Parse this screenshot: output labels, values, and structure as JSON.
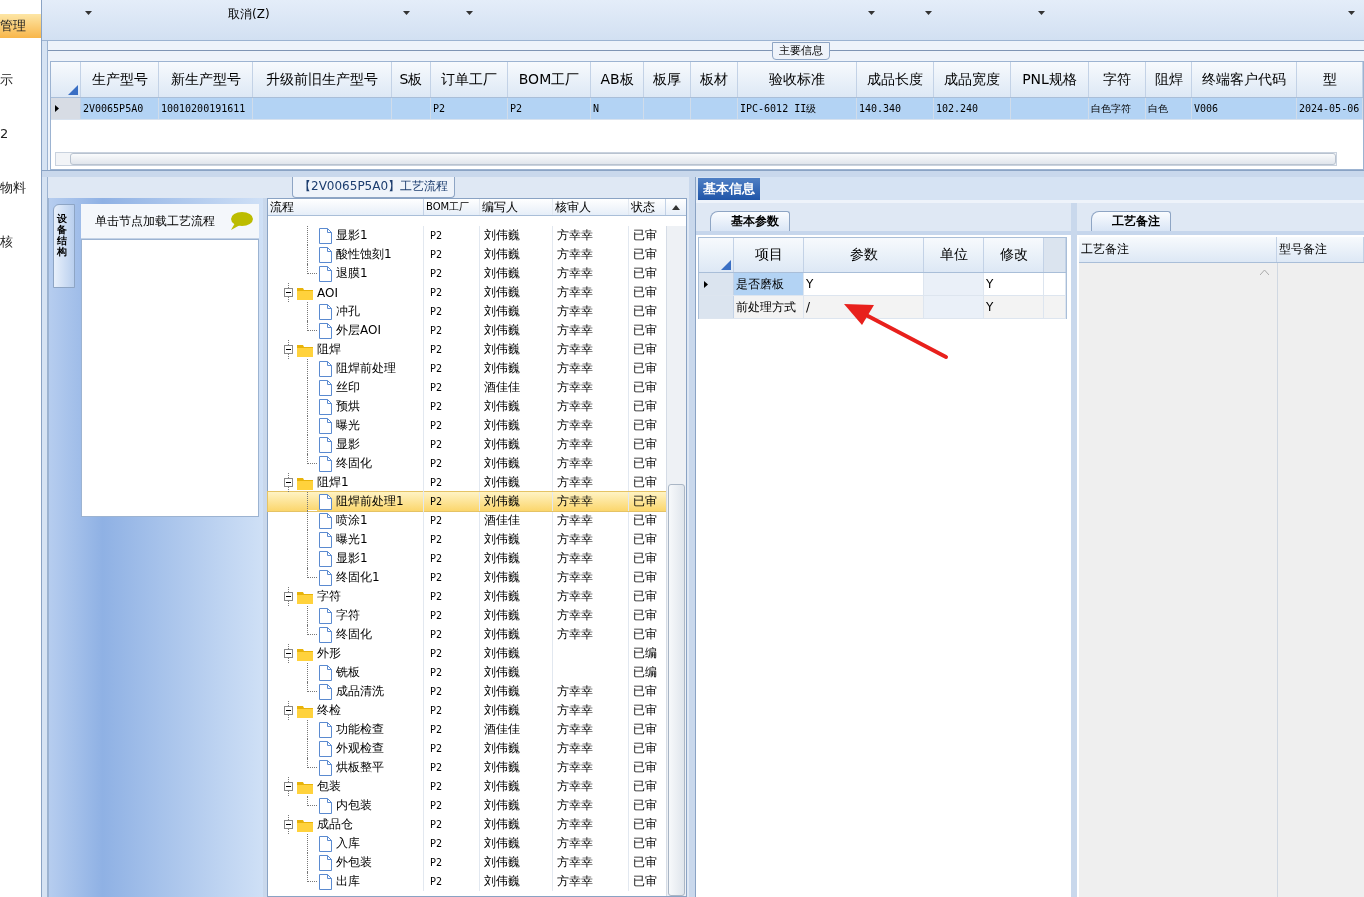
{
  "nav": {
    "items": [
      {
        "label": "管理",
        "selected": true
      },
      {
        "label": "示",
        "selected": false
      },
      {
        "label": "2",
        "selected": false
      },
      {
        "label": "物料",
        "selected": false
      },
      {
        "label": "核",
        "selected": false
      }
    ]
  },
  "ribbon": {
    "cancel_label": "取消(Z)"
  },
  "main_info": {
    "title": "主要信息",
    "columns": [
      "生产型号",
      "新生产型号",
      "升级前旧生产型号",
      "S板",
      "订单工厂",
      "BOM工厂",
      "AB板",
      "板厚",
      "板材",
      "验收标准",
      "成品长度",
      "成品宽度",
      "PNL规格",
      "字符",
      "阻焊",
      "终端客户代码",
      "型"
    ],
    "rows": [
      {
        "selected": true,
        "cells": [
          "2V0065P5A0",
          "10010200191611",
          "",
          "",
          "P2",
          "P2",
          "N",
          "",
          "",
          "IPC-6012 II级",
          "140.340",
          "102.240",
          "",
          "白色字符",
          "白色",
          "V006",
          "2024-05-06"
        ]
      }
    ]
  },
  "flow_panel": {
    "title": "【2V0065P5A0】工艺流程",
    "side_tab": "设备结构",
    "hint": "单击节点加载工艺流程",
    "columns": [
      "流程",
      "BOM工厂",
      "编写人",
      "核审人",
      "状态"
    ],
    "groups": [
      {
        "children": [
          {
            "label": "显影1",
            "factory": "P2",
            "writer": "刘伟巍",
            "reviewer": "方幸幸",
            "status": "已审",
            "selected": false
          },
          {
            "label": "酸性蚀刻1",
            "factory": "P2",
            "writer": "刘伟巍",
            "reviewer": "方幸幸",
            "status": "已审",
            "selected": false
          },
          {
            "label": "退膜1",
            "factory": "P2",
            "writer": "刘伟巍",
            "reviewer": "方幸幸",
            "status": "已审",
            "selected": false
          }
        ]
      },
      {
        "label": "AOI",
        "factory": "P2",
        "writer": "刘伟巍",
        "reviewer": "方幸幸",
        "status": "已审",
        "expanded": true,
        "selected": false,
        "children": [
          {
            "label": "冲孔",
            "factory": "P2",
            "writer": "刘伟巍",
            "reviewer": "方幸幸",
            "status": "已审",
            "selected": false
          },
          {
            "label": "外层AOI",
            "factory": "P2",
            "writer": "刘伟巍",
            "reviewer": "方幸幸",
            "status": "已审",
            "selected": false
          }
        ]
      },
      {
        "label": "阻焊",
        "factory": "P2",
        "writer": "刘伟巍",
        "reviewer": "方幸幸",
        "status": "已审",
        "expanded": true,
        "selected": false,
        "children": [
          {
            "label": "阻焊前处理",
            "factory": "P2",
            "writer": "刘伟巍",
            "reviewer": "方幸幸",
            "status": "已审",
            "selected": false
          },
          {
            "label": "丝印",
            "factory": "P2",
            "writer": "酒佳佳",
            "reviewer": "方幸幸",
            "status": "已审",
            "selected": false
          },
          {
            "label": "预烘",
            "factory": "P2",
            "writer": "刘伟巍",
            "reviewer": "方幸幸",
            "status": "已审",
            "selected": false
          },
          {
            "label": "曝光",
            "factory": "P2",
            "writer": "刘伟巍",
            "reviewer": "方幸幸",
            "status": "已审",
            "selected": false
          },
          {
            "label": "显影",
            "factory": "P2",
            "writer": "刘伟巍",
            "reviewer": "方幸幸",
            "status": "已审",
            "selected": false
          },
          {
            "label": "终固化",
            "factory": "P2",
            "writer": "刘伟巍",
            "reviewer": "方幸幸",
            "status": "已审",
            "selected": false
          }
        ]
      },
      {
        "label": "阻焊1",
        "factory": "P2",
        "writer": "刘伟巍",
        "reviewer": "方幸幸",
        "status": "已审",
        "expanded": true,
        "selected": false,
        "children": [
          {
            "label": "阻焊前处理1",
            "factory": "P2",
            "writer": "刘伟巍",
            "reviewer": "方幸幸",
            "status": "已审",
            "selected": true
          },
          {
            "label": "喷涂1",
            "factory": "P2",
            "writer": "酒佳佳",
            "reviewer": "方幸幸",
            "status": "已审",
            "selected": false
          },
          {
            "label": "曝光1",
            "factory": "P2",
            "writer": "刘伟巍",
            "reviewer": "方幸幸",
            "status": "已审",
            "selected": false
          },
          {
            "label": "显影1",
            "factory": "P2",
            "writer": "刘伟巍",
            "reviewer": "方幸幸",
            "status": "已审",
            "selected": false
          },
          {
            "label": "终固化1",
            "factory": "P2",
            "writer": "刘伟巍",
            "reviewer": "方幸幸",
            "status": "已审",
            "selected": false
          }
        ]
      },
      {
        "label": "字符",
        "factory": "P2",
        "writer": "刘伟巍",
        "reviewer": "方幸幸",
        "status": "已审",
        "expanded": true,
        "selected": false,
        "children": [
          {
            "label": "字符",
            "factory": "P2",
            "writer": "刘伟巍",
            "reviewer": "方幸幸",
            "status": "已审",
            "selected": false
          },
          {
            "label": "终固化",
            "factory": "P2",
            "writer": "刘伟巍",
            "reviewer": "方幸幸",
            "status": "已审",
            "selected": false
          }
        ]
      },
      {
        "label": "外形",
        "factory": "P2",
        "writer": "刘伟巍",
        "status": "已编",
        "expanded": true,
        "selected": false,
        "children": [
          {
            "label": "铣板",
            "factory": "P2",
            "writer": "刘伟巍",
            "status": "已编",
            "selected": false
          },
          {
            "label": "成品清洗",
            "factory": "P2",
            "writer": "刘伟巍",
            "reviewer": "方幸幸",
            "status": "已审",
            "selected": false
          }
        ]
      },
      {
        "label": "终检",
        "factory": "P2",
        "writer": "刘伟巍",
        "reviewer": "方幸幸",
        "status": "已审",
        "expanded": true,
        "selected": false,
        "children": [
          {
            "label": "功能检查",
            "factory": "P2",
            "writer": "酒佳佳",
            "reviewer": "方幸幸",
            "status": "已审",
            "selected": false
          },
          {
            "label": "外观检查",
            "factory": "P2",
            "writer": "刘伟巍",
            "reviewer": "方幸幸",
            "status": "已审",
            "selected": false
          },
          {
            "label": "烘板整平",
            "factory": "P2",
            "writer": "刘伟巍",
            "reviewer": "方幸幸",
            "status": "已审",
            "selected": false
          }
        ]
      },
      {
        "label": "包装",
        "factory": "P2",
        "writer": "刘伟巍",
        "reviewer": "方幸幸",
        "status": "已审",
        "expanded": true,
        "selected": false,
        "children": [
          {
            "label": "内包装",
            "factory": "P2",
            "writer": "刘伟巍",
            "reviewer": "方幸幸",
            "status": "已审",
            "selected": false
          }
        ]
      },
      {
        "label": "成品仓",
        "factory": "P2",
        "writer": "刘伟巍",
        "reviewer": "方幸幸",
        "status": "已审",
        "expanded": true,
        "selected": false,
        "children": [
          {
            "label": "入库",
            "factory": "P2",
            "writer": "刘伟巍",
            "reviewer": "方幸幸",
            "status": "已审",
            "selected": false
          },
          {
            "label": "外包装",
            "factory": "P2",
            "writer": "刘伟巍",
            "reviewer": "方幸幸",
            "status": "已审",
            "selected": false
          },
          {
            "label": "出库",
            "factory": "P2",
            "writer": "刘伟巍",
            "reviewer": "方幸幸",
            "status": "已审",
            "selected": false
          }
        ]
      }
    ]
  },
  "info_panel": {
    "tabs": [
      {
        "label": "基本信息",
        "selected": true
      }
    ],
    "params": {
      "tab": "基本参数",
      "columns": [
        "项目",
        "参数",
        "单位",
        "修改"
      ],
      "rows": [
        {
          "selected": true,
          "cells": [
            "是否磨板",
            "Y",
            "",
            "Y"
          ]
        },
        {
          "selected": false,
          "cells": [
            "前处理方式",
            "/",
            "",
            "Y"
          ]
        }
      ]
    },
    "notes": {
      "tab": "工艺备注",
      "columns": [
        "工艺备注",
        "型号备注"
      ]
    }
  }
}
